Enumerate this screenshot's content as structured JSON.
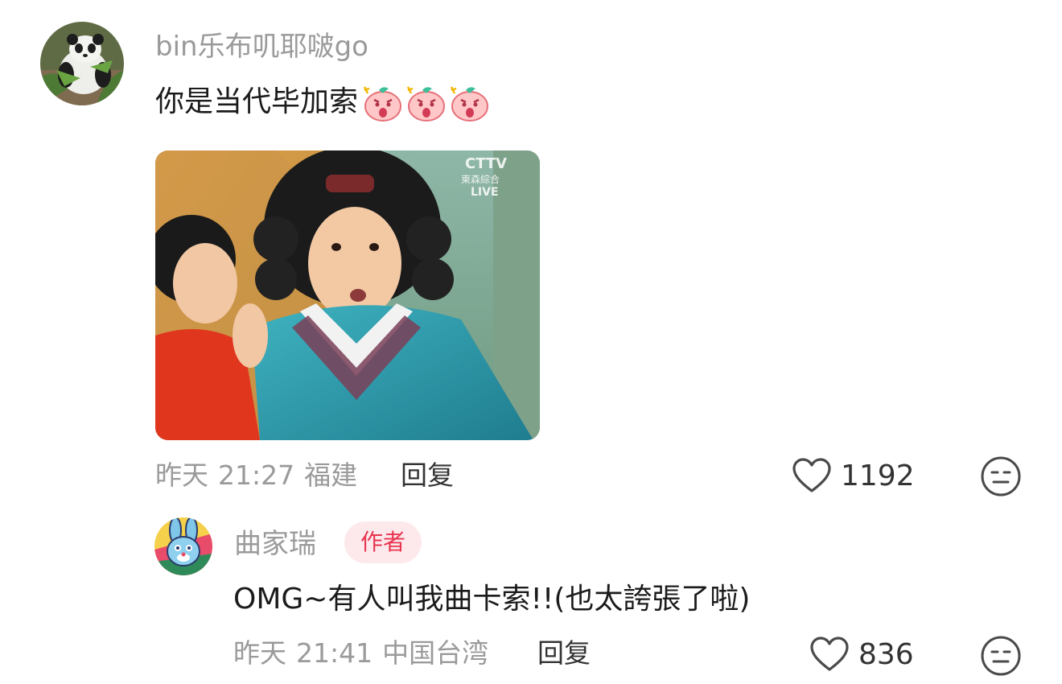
{
  "comment": {
    "username": "bin乐布叽耶啵go",
    "text": "你是当代毕加索",
    "emojis": [
      "shocked-peach-emoji",
      "shocked-peach-emoji",
      "shocked-peach-emoji"
    ],
    "photo_caption": "CTTV 東森綜合 LIVE",
    "date": "昨天",
    "time": "21:27",
    "location": "福建",
    "reply_label": "回复",
    "likes": "1192"
  },
  "reply": {
    "username": "曲家瑞",
    "badge": "作者",
    "text": "OMG~有人叫我曲卡索!!(也太誇張了啦)",
    "date": "昨天",
    "time": "21:41",
    "location": "中国台湾",
    "reply_label": "回复",
    "likes": "836"
  },
  "colors": {
    "meta_gray": "#9a9a9a",
    "badge_bg": "#fde9ec",
    "badge_text": "#e8344f"
  }
}
